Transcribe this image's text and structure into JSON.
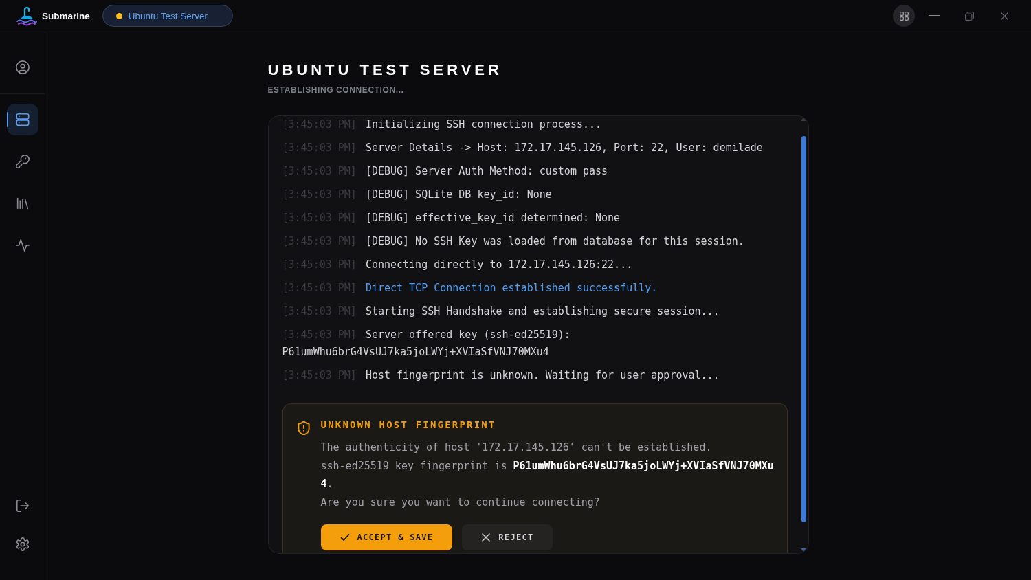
{
  "app": {
    "name": "Submarine"
  },
  "server_tab": {
    "label": "Ubuntu Test Server"
  },
  "sidebar": {
    "items": [
      {
        "selected": false
      },
      {
        "selected": true
      },
      {
        "selected": false
      },
      {
        "selected": false
      },
      {
        "selected": false
      }
    ]
  },
  "page": {
    "title": "UBUNTU TEST SERVER",
    "subtitle": "ESTABLISHING CONNECTION..."
  },
  "log": [
    {
      "time": "[3:45:03 PM]",
      "message": "Initializing SSH connection process...",
      "kind": "info"
    },
    {
      "time": "[3:45:03 PM]",
      "message": "Server Details -> Host: 172.17.145.126, Port: 22, User: demilade",
      "kind": "info"
    },
    {
      "time": "[3:45:03 PM]",
      "message": "[DEBUG] Server Auth Method: custom_pass",
      "kind": "info"
    },
    {
      "time": "[3:45:03 PM]",
      "message": "[DEBUG] SQLite DB key_id: None",
      "kind": "info"
    },
    {
      "time": "[3:45:03 PM]",
      "message": "[DEBUG] effective_key_id determined: None",
      "kind": "info"
    },
    {
      "time": "[3:45:03 PM]",
      "message": "[DEBUG] No SSH Key was loaded from database for this session.",
      "kind": "info"
    },
    {
      "time": "[3:45:03 PM]",
      "message": "Connecting directly to 172.17.145.126:22...",
      "kind": "info"
    },
    {
      "time": "[3:45:03 PM]",
      "message": "Direct TCP Connection established successfully.",
      "kind": "success"
    },
    {
      "time": "[3:45:03 PM]",
      "message": "Starting SSH Handshake and establishing secure session...",
      "kind": "info"
    },
    {
      "time": "[3:45:03 PM]",
      "message": "Server offered key (ssh-ed25519):",
      "continuation": "P61umWhu6brG4VsUJ7ka5joLWYj+XVIaSfVNJ70MXu4",
      "kind": "info"
    },
    {
      "time": "[3:45:03 PM]",
      "message": "Host fingerprint is unknown. Waiting for user approval...",
      "kind": "info"
    }
  ],
  "prompt": {
    "title": "UNKNOWN HOST FINGERPRINT",
    "lines": [
      "The authenticity of host '172.17.145.126' can't be established.",
      "ssh-ed25519 key fingerprint is **P61umWhu6brG4VsUJ7ka5joLWYj+XVIaSfVNJ70MXu4**.",
      "Are you sure you want to continue connecting?"
    ],
    "buttons": [
      {
        "label": "ACCEPT & SAVE",
        "kind": "primary"
      },
      {
        "label": "REJECT",
        "kind": "secondary"
      }
    ]
  }
}
